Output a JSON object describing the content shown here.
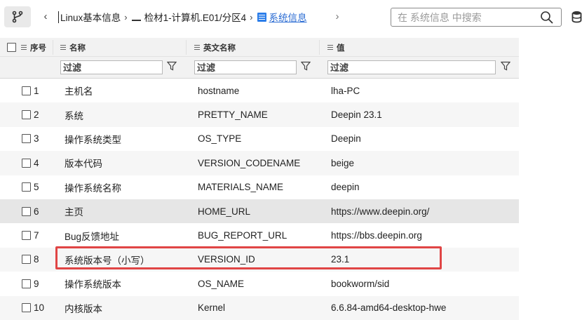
{
  "toolbar": {
    "breadcrumb": [
      "Linux基本信息",
      "检材1-计算机.E01/分区4",
      "系统信息"
    ],
    "search_placeholder": "在 系统信息 中搜索"
  },
  "grid": {
    "columns": [
      "序号",
      "名称",
      "英文名称",
      "值"
    ],
    "filter_placeholder": "过滤",
    "rows": [
      {
        "index": "1",
        "name": "主机名",
        "english": "hostname",
        "value": "lha-PC"
      },
      {
        "index": "2",
        "name": "系统",
        "english": "PRETTY_NAME",
        "value": "Deepin 23.1"
      },
      {
        "index": "3",
        "name": "操作系统类型",
        "english": "OS_TYPE",
        "value": "Deepin"
      },
      {
        "index": "4",
        "name": "版本代码",
        "english": "VERSION_CODENAME",
        "value": "beige"
      },
      {
        "index": "5",
        "name": "操作系统名称",
        "english": "MATERIALS_NAME",
        "value": "deepin"
      },
      {
        "index": "6",
        "name": "主页",
        "english": "HOME_URL",
        "value": "https://www.deepin.org/"
      },
      {
        "index": "7",
        "name": "Bug反馈地址",
        "english": "BUG_REPORT_URL",
        "value": "https://bbs.deepin.org"
      },
      {
        "index": "8",
        "name": "系统版本号（小写）",
        "english": "VERSION_ID",
        "value": "23.1"
      },
      {
        "index": "9",
        "name": "操作系统版本",
        "english": "OS_NAME",
        "value": "bookworm/sid"
      },
      {
        "index": "10",
        "name": "内核版本",
        "english": "Kernel",
        "value": "6.6.84-amd64-desktop-hwe"
      }
    ]
  },
  "colors": {
    "accent": "#2b6cd3",
    "highlight": "#e04545",
    "header_bg": "#f2f2f2"
  }
}
